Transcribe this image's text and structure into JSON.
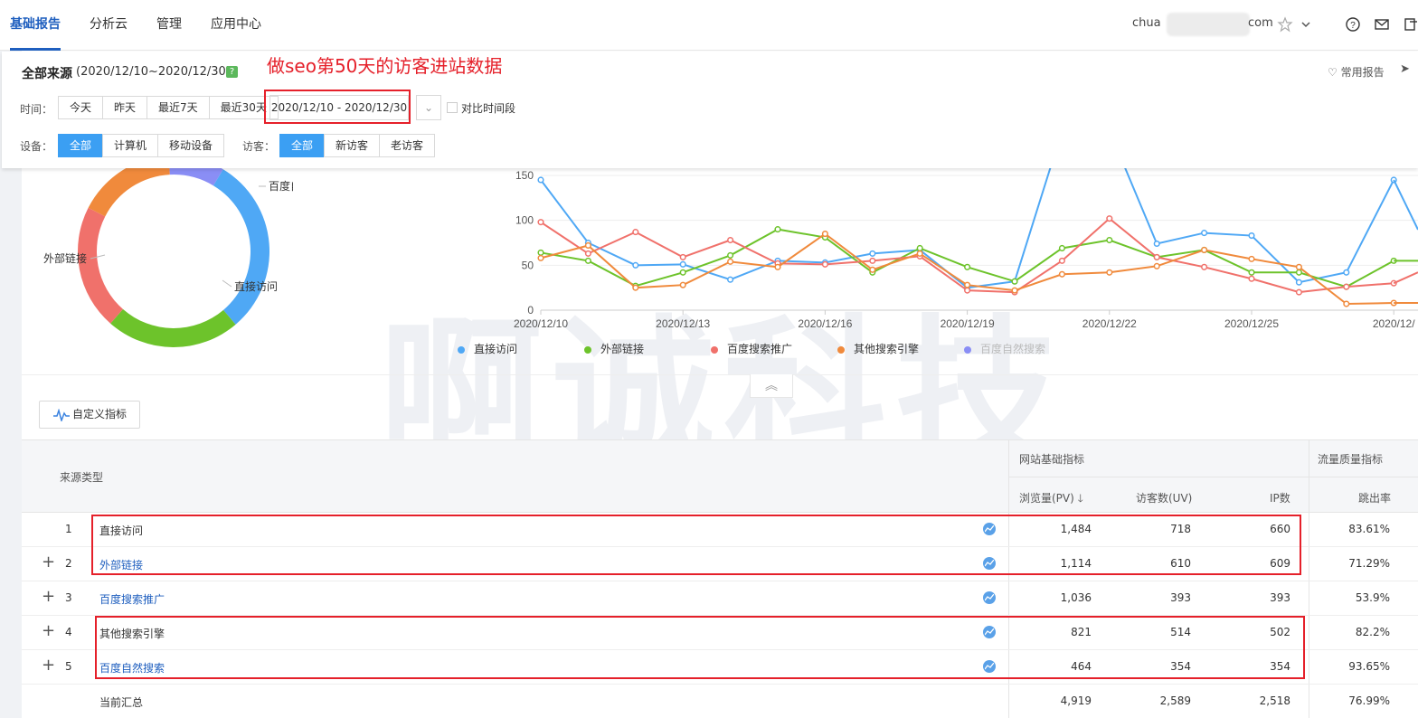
{
  "nav": {
    "items": [
      "基础报告",
      "分析云",
      "管理",
      "应用中心"
    ],
    "active": "基础报告",
    "user_prefix": "chua",
    "user_suffix": "com"
  },
  "filter": {
    "title": "全部来源",
    "date_text": "(2020/12/10~2020/12/30)",
    "help": "?",
    "annotation": "做seo第50天的访客进站数据",
    "favorites": "常用报告",
    "time_label": "时间：",
    "time_buttons": [
      "今天",
      "昨天",
      "最近7天",
      "最近30天"
    ],
    "date_range": "2020/12/10 - 2020/12/30",
    "compare_label": "对比时间段",
    "device_label": "设备：",
    "device_buttons": [
      "全部",
      "计算机",
      "移动设备"
    ],
    "visitor_label": "访客：",
    "visitor_buttons": [
      "全部",
      "新访客",
      "老访客"
    ]
  },
  "donut": {
    "labels": [
      "百度自然搜索",
      "外部链接",
      "直接访问"
    ]
  },
  "chart_data": [
    {
      "type": "pie",
      "labels": [
        "直接访问",
        "外部链接",
        "百度搜索推广",
        "其他搜索引擎",
        "百度自然搜索"
      ],
      "values": [
        1484,
        1114,
        1036,
        821,
        464
      ],
      "colors": [
        "#4fa8f5",
        "#6dc32b",
        "#f0716b",
        "#f08a3c",
        "#8a8ef5"
      ]
    },
    {
      "type": "line",
      "x": [
        "2020/12/10",
        "2020/12/11",
        "2020/12/12",
        "2020/12/13",
        "2020/12/14",
        "2020/12/15",
        "2020/12/16",
        "2020/12/17",
        "2020/12/18",
        "2020/12/19",
        "2020/12/20",
        "2020/12/21",
        "2020/12/22",
        "2020/12/23",
        "2020/12/24",
        "2020/12/25",
        "2020/12/26",
        "2020/12/27",
        "2020/12/28"
      ],
      "x_ticks": [
        "2020/12/10",
        "2020/12/13",
        "2020/12/16",
        "2020/12/19",
        "2020/12/22",
        "2020/12/25",
        "2020/12/"
      ],
      "y_ticks": [
        0,
        50,
        100,
        150
      ],
      "ylim": [
        0,
        150
      ],
      "series": [
        {
          "name": "直接访问",
          "color": "#4fa8f5",
          "values": [
            145,
            75,
            50,
            51,
            34,
            55,
            53,
            63,
            67,
            25,
            32,
            200,
            200,
            74,
            86,
            83,
            31,
            42,
            145
          ]
        },
        {
          "name": "外部链接",
          "color": "#6dc32b",
          "values": [
            64,
            55,
            27,
            42,
            61,
            90,
            81,
            42,
            69,
            48,
            32,
            69,
            78,
            59,
            67,
            42,
            42,
            26,
            55
          ]
        },
        {
          "name": "百度搜索推广",
          "color": "#f0716b",
          "values": [
            98,
            63,
            87,
            59,
            78,
            52,
            51,
            55,
            60,
            22,
            20,
            55,
            102,
            59,
            48,
            35,
            20,
            26,
            30
          ]
        },
        {
          "name": "其他搜索引擎",
          "color": "#f08a3c",
          "values": [
            58,
            72,
            25,
            28,
            54,
            48,
            85,
            45,
            63,
            28,
            22,
            40,
            42,
            49,
            67,
            57,
            48,
            7,
            8
          ]
        },
        {
          "name": "百度自然搜索",
          "color": "#8a8ef5",
          "values": []
        }
      ]
    }
  ],
  "legend": [
    "直接访问",
    "外部链接",
    "百度搜索推广",
    "其他搜索引擎",
    "百度自然搜索"
  ],
  "custom_button": "自定义指标",
  "table": {
    "col_source": "来源类型",
    "group_basic": "网站基础指标",
    "group_quality": "流量质量指标",
    "col_pv": "浏览量(PV)",
    "col_uv": "访客数(UV)",
    "col_ip": "IP数",
    "col_bounce": "跳出率",
    "rows": [
      {
        "idx": "1",
        "name": "直接访问",
        "pv": "1,484",
        "uv": "718",
        "ip": "660",
        "bounce": "83.61%"
      },
      {
        "idx": "2",
        "name": "外部链接",
        "pv": "1,114",
        "uv": "610",
        "ip": "609",
        "bounce": "71.29%"
      },
      {
        "idx": "3",
        "name": "百度搜索推广",
        "pv": "1,036",
        "uv": "393",
        "ip": "393",
        "bounce": "53.9%"
      },
      {
        "idx": "4",
        "name": "其他搜索引擎",
        "pv": "821",
        "uv": "514",
        "ip": "502",
        "bounce": "82.2%"
      },
      {
        "idx": "5",
        "name": "百度自然搜索",
        "pv": "464",
        "uv": "354",
        "ip": "354",
        "bounce": "93.65%"
      }
    ],
    "total": {
      "name": "当前汇总",
      "pv": "4,919",
      "uv": "2,589",
      "ip": "2,518",
      "bounce": "76.99%"
    }
  },
  "watermark": "啊诚科技"
}
